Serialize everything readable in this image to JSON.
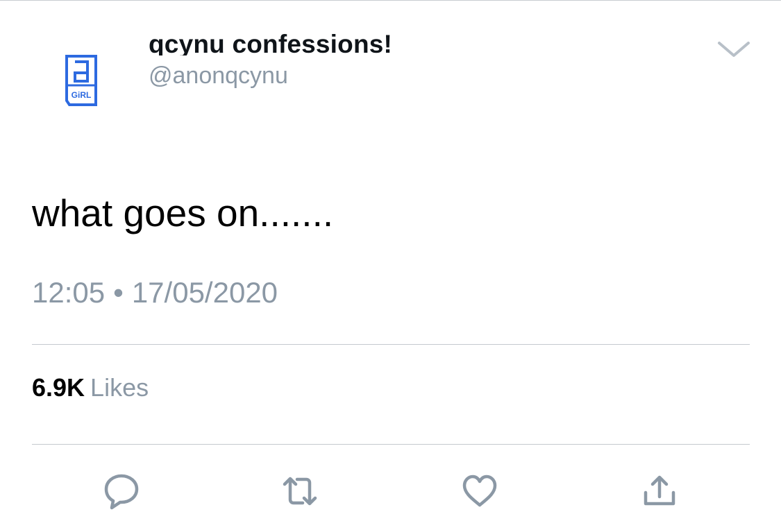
{
  "tweet": {
    "display_name": "qcynu confessions!",
    "handle": "@anonqcynu",
    "avatar": {
      "icon": "girl-logo",
      "text": "GiRL",
      "color": "#2d6ae0"
    },
    "text": "what goes on.......",
    "time": "12:05",
    "separator": "•",
    "date": "17/05/2020",
    "likes_count": "6.9K",
    "likes_label": "Likes"
  },
  "actions": [
    {
      "icon": "reply-icon"
    },
    {
      "icon": "retweet-icon"
    },
    {
      "icon": "like-icon"
    },
    {
      "icon": "share-icon"
    }
  ],
  "colors": {
    "icon_gray": "#8b98a5",
    "divider": "#c4c9ce",
    "brand_blue": "#2d6ae0"
  }
}
